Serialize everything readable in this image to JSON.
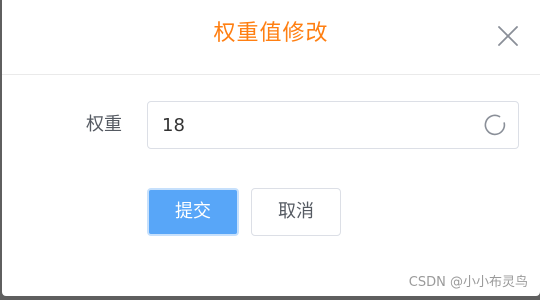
{
  "dialog": {
    "title": "权重值修改",
    "close_icon": "close-icon"
  },
  "form": {
    "weight_label": "权重",
    "weight_value": "18",
    "loading_icon": "loading-spinner-icon"
  },
  "actions": {
    "submit_label": "提交",
    "cancel_label": "取消"
  },
  "watermark": {
    "text": "CSDN @小小布灵鸟"
  },
  "colors": {
    "title": "#ff7f12",
    "primary": "#58a6f8",
    "border": "#dcdfe6",
    "overlay": "#5f5f5f"
  }
}
